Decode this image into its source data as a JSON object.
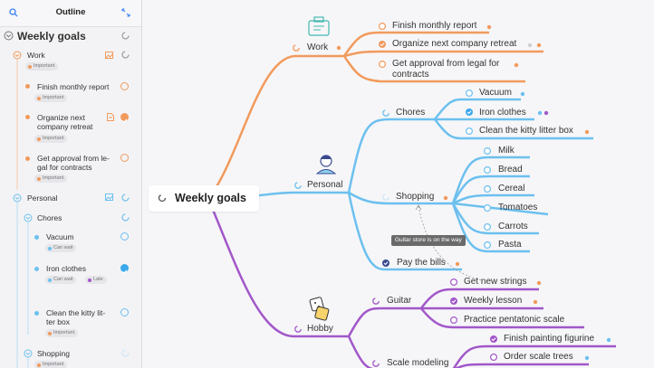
{
  "colors": {
    "work": "#f19a5c",
    "personal": "#6cc0ef",
    "hobby": "#a257c9",
    "tag_dot_orange": "#f19a5c",
    "tag_dot_purple": "#a257c9"
  },
  "sidebar": {
    "title": "Outline",
    "search_icon": "search-icon",
    "collapse_icon": "collapse-arrows-icon",
    "root": "Weekly goals",
    "items": {
      "work": {
        "label": "Work",
        "tag": "Important"
      },
      "finish": {
        "label": "Finish monthly report",
        "tag": "Important"
      },
      "organize_l1": "Organize next",
      "organize_l2": "company retreat",
      "organize_tag": "Important",
      "approval_l1": "Get approval from le-",
      "approval_l2": "gal for contracts",
      "approval_tag": "Important",
      "personal": {
        "label": "Personal"
      },
      "chores": {
        "label": "Chores"
      },
      "vacuum": {
        "label": "Vacuum",
        "tag": "Can wait"
      },
      "iron": {
        "label": "Iron clothes",
        "tag1": "Can wait",
        "tag2": "Late"
      },
      "kitty_l1": "Clean the kitty lit-",
      "kitty_l2": "ter box",
      "kitty_tag": "Important",
      "shopping": {
        "label": "Shopping",
        "tag": "Important"
      }
    }
  },
  "map": {
    "root": "Weekly goals",
    "work": {
      "label": "Work",
      "children": [
        "Finish monthly report",
        "Organize next company retreat",
        "Get approval from legal for",
        "contracts"
      ]
    },
    "personal": {
      "label": "Personal",
      "chores": "Chores",
      "chores_children": [
        "Vacuum",
        "Iron clothes",
        "Clean the kitty litter box"
      ],
      "shopping": "Shopping",
      "shopping_children": [
        "Milk",
        "Bread",
        "Cereal",
        "Tomatoes",
        "Carrots",
        "Pasta"
      ],
      "pay": "Pay the bills"
    },
    "hobby": {
      "label": "Hobby",
      "guitar": "Guitar",
      "guitar_children": [
        "Get new strings",
        "Weekly lesson",
        "Practice pentatonic scale"
      ],
      "scale": "Scale modeling",
      "scale_children": [
        "Finish painting figurine",
        "Order scale trees"
      ]
    },
    "tooltip": "Guitar store is on the way"
  }
}
